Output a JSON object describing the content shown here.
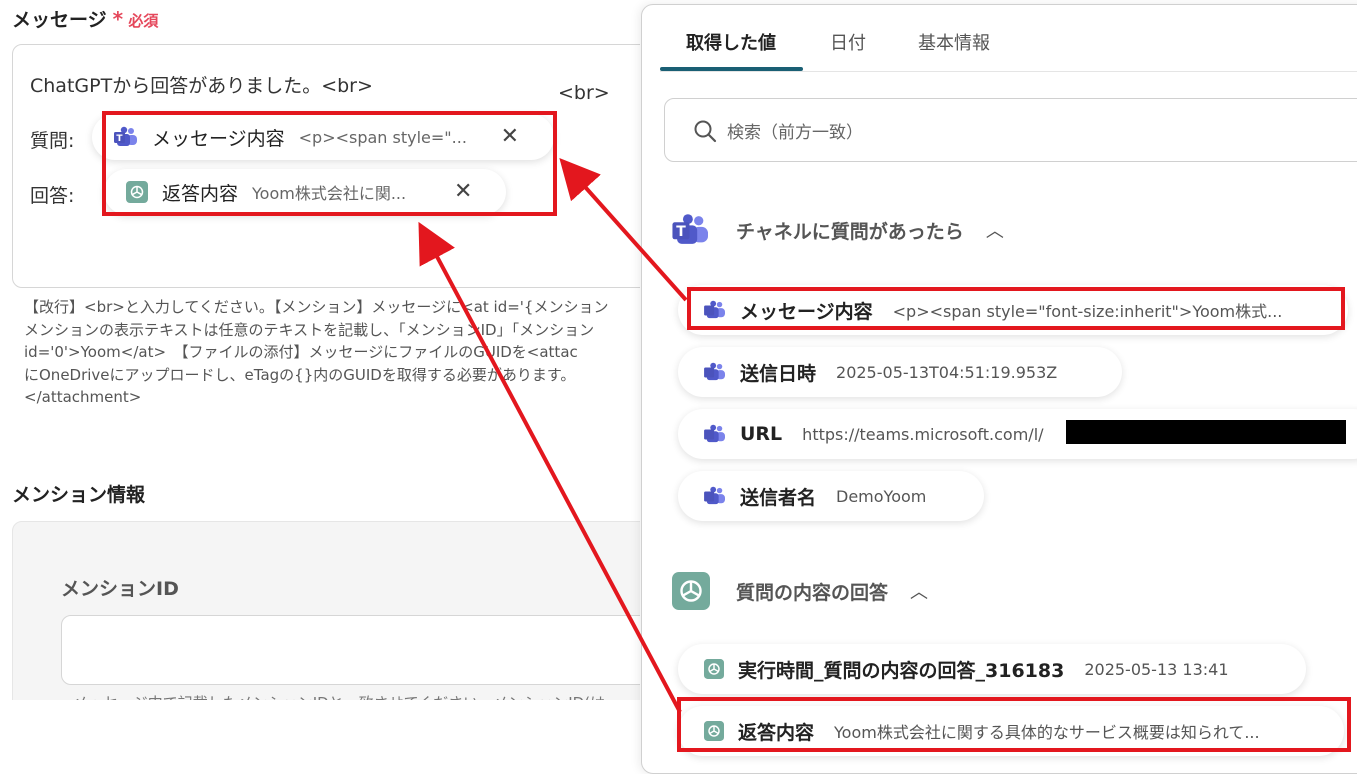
{
  "form": {
    "message_label": "メッセージ",
    "required_label": "必須",
    "message_line1": "ChatGPTから回答がありました。<br>",
    "question_label": "質問:",
    "answer_label": "回答:",
    "chip_question_name": "メッセージ内容",
    "chip_question_value": "<p><span style=\"...",
    "chip_answer_name": "返答内容",
    "chip_answer_value": "Yoom株式会社に関...",
    "trailing_br": "<br>",
    "help_lines": [
      "【改行】<br>と入力してください。【メンション】メッセージに<at id='{メンション",
      "メンションの表示テキストは任意のテキストを記載し、「メンションID」「メンション",
      "id='0'>Yoom</at>　【ファイルの添付】メッセージにファイルのGUIDを<attac",
      "にOneDriveにアップロードし、eTagの{}内のGUIDを取得する必要があります。",
      "</attachment>"
    ],
    "mention_section_title": "メンション情報",
    "mention_id_label": "メンションID",
    "mention_help": "メッセージ中で記載したメンションIDと一致させてください。メンションID(は"
  },
  "panel": {
    "tabs": [
      "取得した値",
      "日付",
      "基本情報"
    ],
    "search_placeholder": "検索（前方一致）",
    "groups": [
      {
        "title": "チャネルに質問があったら",
        "icon": "teams-icon",
        "items": [
          {
            "name": "メッセージ内容",
            "value": "<p><span style=\"font-size:inherit\">Yoom株式..."
          },
          {
            "name": "送信日時",
            "value": "2025-05-13T04:51:19.953Z"
          },
          {
            "name": "URL",
            "value": "https://teams.microsoft.com/l/"
          },
          {
            "name": "送信者名",
            "value": "DemoYoom"
          }
        ]
      },
      {
        "title": "質問の内容の回答",
        "icon": "openai-icon",
        "items": [
          {
            "name": "実行時間_質問の内容の回答_316183",
            "value": "2025-05-13 13:41"
          },
          {
            "name": "返答内容",
            "value": "Yoom株式会社に関する具体的なサービス概要は知られて..."
          }
        ]
      }
    ]
  },
  "colors": {
    "accent_tab": "#1a5f74",
    "required": "#e5475b",
    "annotation": "#e3171e",
    "teams": "#5059c9",
    "openai": "#74aa9c"
  }
}
